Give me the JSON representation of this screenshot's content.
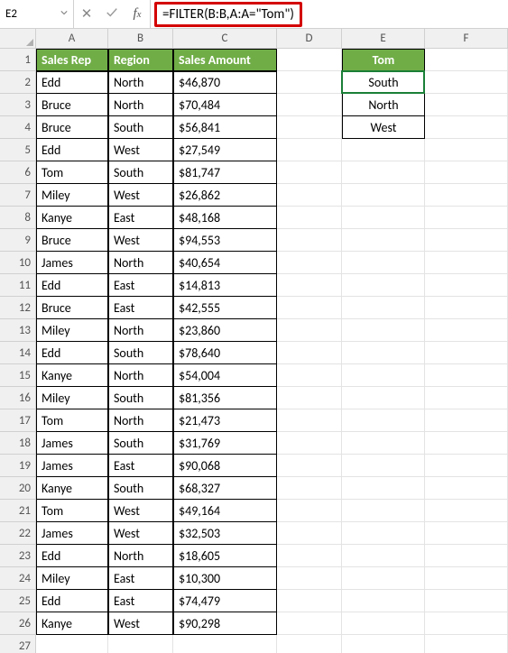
{
  "name_box": "E2",
  "formula": "=FILTER(B:B,A:A=\"Tom\")",
  "columns": [
    "A",
    "B",
    "C",
    "D",
    "E",
    "F"
  ],
  "col_widths": {
    "A": 80,
    "B": 72,
    "C": 115,
    "D": 72,
    "E": 92,
    "F": 92
  },
  "row_count": 27,
  "headers": {
    "A": "Sales Rep",
    "B": "Region",
    "C": "Sales Amount"
  },
  "table": [
    {
      "rep": "Edd",
      "region": "North",
      "amount": "$46,870"
    },
    {
      "rep": "Bruce",
      "region": "North",
      "amount": "$70,484"
    },
    {
      "rep": "Bruce",
      "region": "South",
      "amount": "$56,841"
    },
    {
      "rep": "Edd",
      "region": "West",
      "amount": "$27,549"
    },
    {
      "rep": "Tom",
      "region": "South",
      "amount": "$81,747"
    },
    {
      "rep": "Miley",
      "region": "West",
      "amount": "$26,862"
    },
    {
      "rep": "Kanye",
      "region": "East",
      "amount": "$48,168"
    },
    {
      "rep": "Bruce",
      "region": "West",
      "amount": "$94,553"
    },
    {
      "rep": "James",
      "region": "North",
      "amount": "$40,654"
    },
    {
      "rep": "Edd",
      "region": "East",
      "amount": "$14,813"
    },
    {
      "rep": "Bruce",
      "region": "East",
      "amount": "$42,555"
    },
    {
      "rep": "Miley",
      "region": "North",
      "amount": "$23,860"
    },
    {
      "rep": "Edd",
      "region": "South",
      "amount": "$78,640"
    },
    {
      "rep": "Kanye",
      "region": "North",
      "amount": "$54,004"
    },
    {
      "rep": "Miley",
      "region": "South",
      "amount": "$81,356"
    },
    {
      "rep": "Tom",
      "region": "North",
      "amount": "$21,473"
    },
    {
      "rep": "James",
      "region": "South",
      "amount": "$31,769"
    },
    {
      "rep": "James",
      "region": "East",
      "amount": "$90,068"
    },
    {
      "rep": "Kanye",
      "region": "South",
      "amount": "$68,327"
    },
    {
      "rep": "Tom",
      "region": "West",
      "amount": "$49,164"
    },
    {
      "rep": "James",
      "region": "West",
      "amount": "$32,503"
    },
    {
      "rep": "Edd",
      "region": "North",
      "amount": "$18,605"
    },
    {
      "rep": "Miley",
      "region": "East",
      "amount": "$10,300"
    },
    {
      "rep": "Edd",
      "region": "East",
      "amount": "$74,479"
    },
    {
      "rep": "Kanye",
      "region": "West",
      "amount": "$90,298"
    }
  ],
  "side_table": {
    "header": "Tom",
    "values": [
      "South",
      "North",
      "West"
    ]
  },
  "selection": {
    "cell": "E2",
    "col": "E",
    "row": 2
  }
}
